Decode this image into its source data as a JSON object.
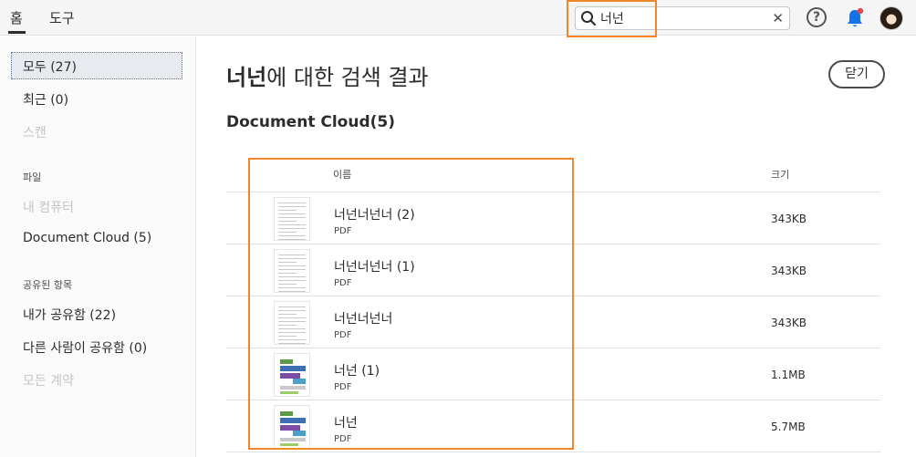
{
  "topbar": {
    "tabs": [
      "홈",
      "도구"
    ],
    "search": {
      "value": "너넌"
    },
    "clear_glyph": "✕",
    "help_glyph": "?",
    "icons": [
      "search-icon",
      "clear-icon",
      "help-icon",
      "bell-icon",
      "avatar"
    ]
  },
  "sidebar": {
    "all": "모두 (27)",
    "recent": "최근 (0)",
    "scan": "스캔",
    "files_heading": "파일",
    "my_computer": "내 컴퓨터",
    "document_cloud": "Document Cloud (5)",
    "shared_heading": "공유된 항목",
    "shared_by_me": "내가 공유함 (22)",
    "shared_by_others": "다른 사람이 공유함 (0)",
    "all_agreements": "모든 계약"
  },
  "main": {
    "query": "너넌",
    "title_suffix": "에 대한 검색 결과",
    "close_label": "닫기",
    "section_title": "Document Cloud(5)",
    "columns": {
      "name": "이름",
      "size": "크기"
    },
    "files": [
      {
        "name": "너넌너넌너 (2)",
        "type": "PDF",
        "size": "343KB",
        "thumb": "text"
      },
      {
        "name": "너넌너넌너 (1)",
        "type": "PDF",
        "size": "343KB",
        "thumb": "text"
      },
      {
        "name": "너넌너넌너",
        "type": "PDF",
        "size": "343KB",
        "thumb": "text"
      },
      {
        "name": "너넌 (1)",
        "type": "PDF",
        "size": "1.1MB",
        "thumb": "color"
      },
      {
        "name": "너넌",
        "type": "PDF",
        "size": "5.7MB",
        "thumb": "color"
      }
    ]
  },
  "colors": {
    "highlight": "#f0872b",
    "notification_dot": "#e34850",
    "bell": "#1473e6"
  }
}
